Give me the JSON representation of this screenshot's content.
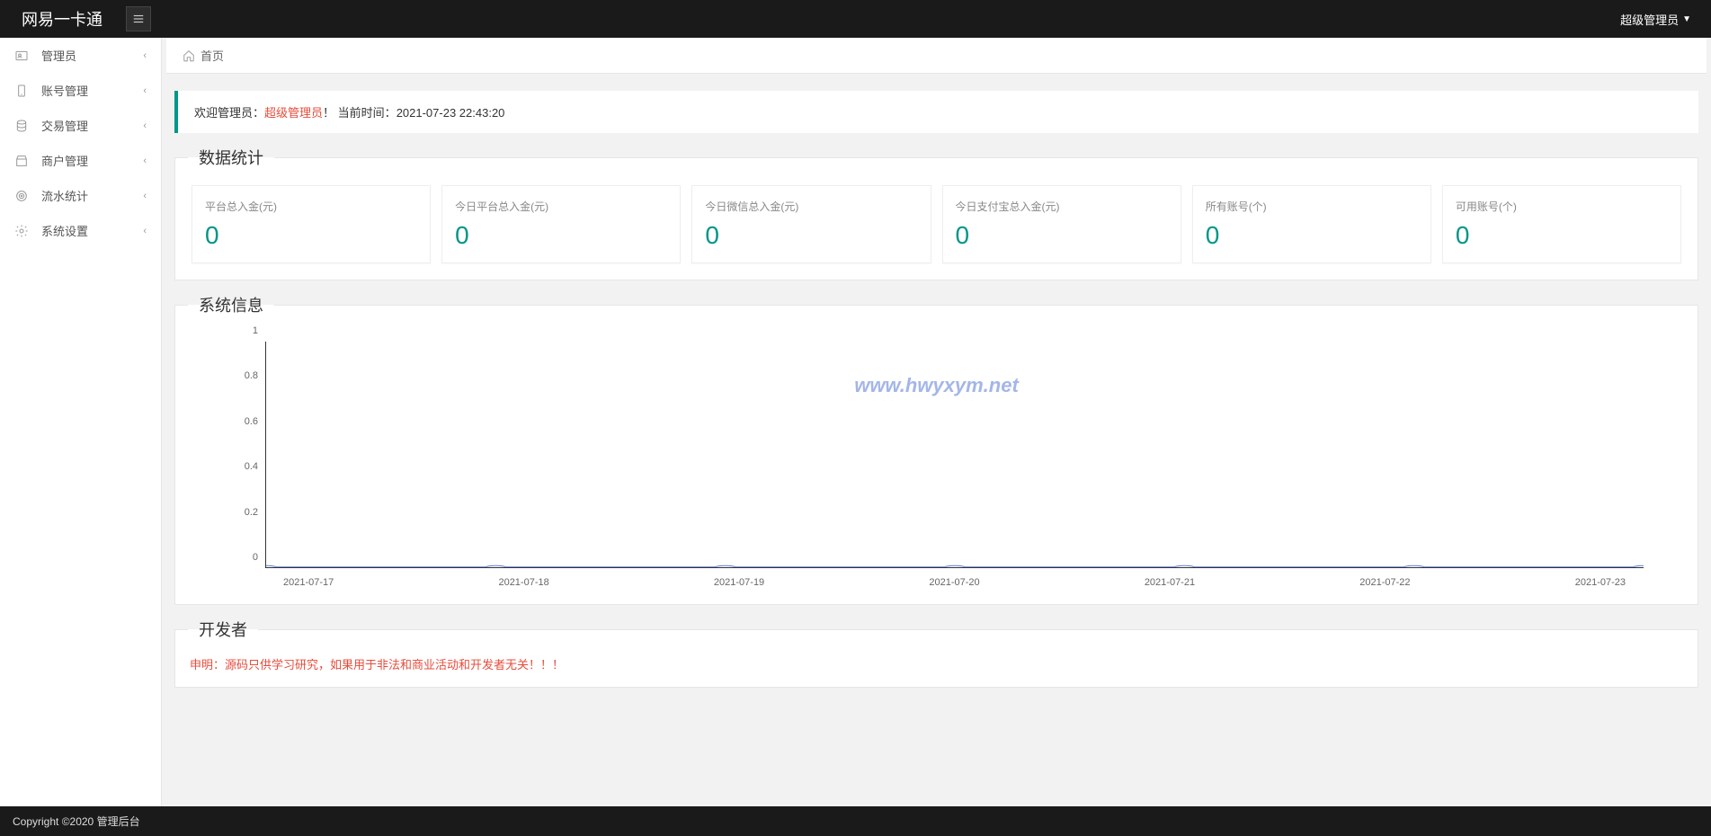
{
  "header": {
    "logo": "网易一卡通",
    "user": "超级管理员"
  },
  "sidebar": {
    "items": [
      {
        "label": "管理员",
        "icon": "admin"
      },
      {
        "label": "账号管理",
        "icon": "account"
      },
      {
        "label": "交易管理",
        "icon": "trade"
      },
      {
        "label": "商户管理",
        "icon": "merchant"
      },
      {
        "label": "流水统计",
        "icon": "stats"
      },
      {
        "label": "系统设置",
        "icon": "settings"
      }
    ]
  },
  "breadcrumb": {
    "home": "首页"
  },
  "welcome": {
    "prefix": "欢迎管理员：",
    "name": "超级管理员",
    "exclaim": "！",
    "time_label": "当前时间：",
    "time_value": "2021-07-23 22:43:20"
  },
  "sections": {
    "stats_title": "数据统计",
    "sysinfo_title": "系统信息",
    "dev_title": "开发者"
  },
  "stats": [
    {
      "label": "平台总入金(元)",
      "value": "0"
    },
    {
      "label": "今日平台总入金(元)",
      "value": "0"
    },
    {
      "label": "今日微信总入金(元)",
      "value": "0"
    },
    {
      "label": "今日支付宝总入金(元)",
      "value": "0"
    },
    {
      "label": "所有账号(个)",
      "value": "0"
    },
    {
      "label": "可用账号(个)",
      "value": "0"
    }
  ],
  "chart_data": {
    "type": "line",
    "categories": [
      "2021-07-17",
      "2021-07-18",
      "2021-07-19",
      "2021-07-20",
      "2021-07-21",
      "2021-07-22",
      "2021-07-23"
    ],
    "values": [
      0,
      0,
      0,
      0,
      0,
      0,
      0
    ],
    "ylim": [
      0,
      1
    ],
    "yticks": [
      0,
      0.2,
      0.4,
      0.6,
      0.8,
      1
    ],
    "xlabel": "",
    "ylabel": "",
    "title": ""
  },
  "watermark": "www.hwyxym.net",
  "developer": {
    "disclaimer": "申明：源码只供学习研究，如果用于非法和商业活动和开发者无关！！！"
  },
  "footer": {
    "text": "Copyright ©2020 管理后台"
  }
}
